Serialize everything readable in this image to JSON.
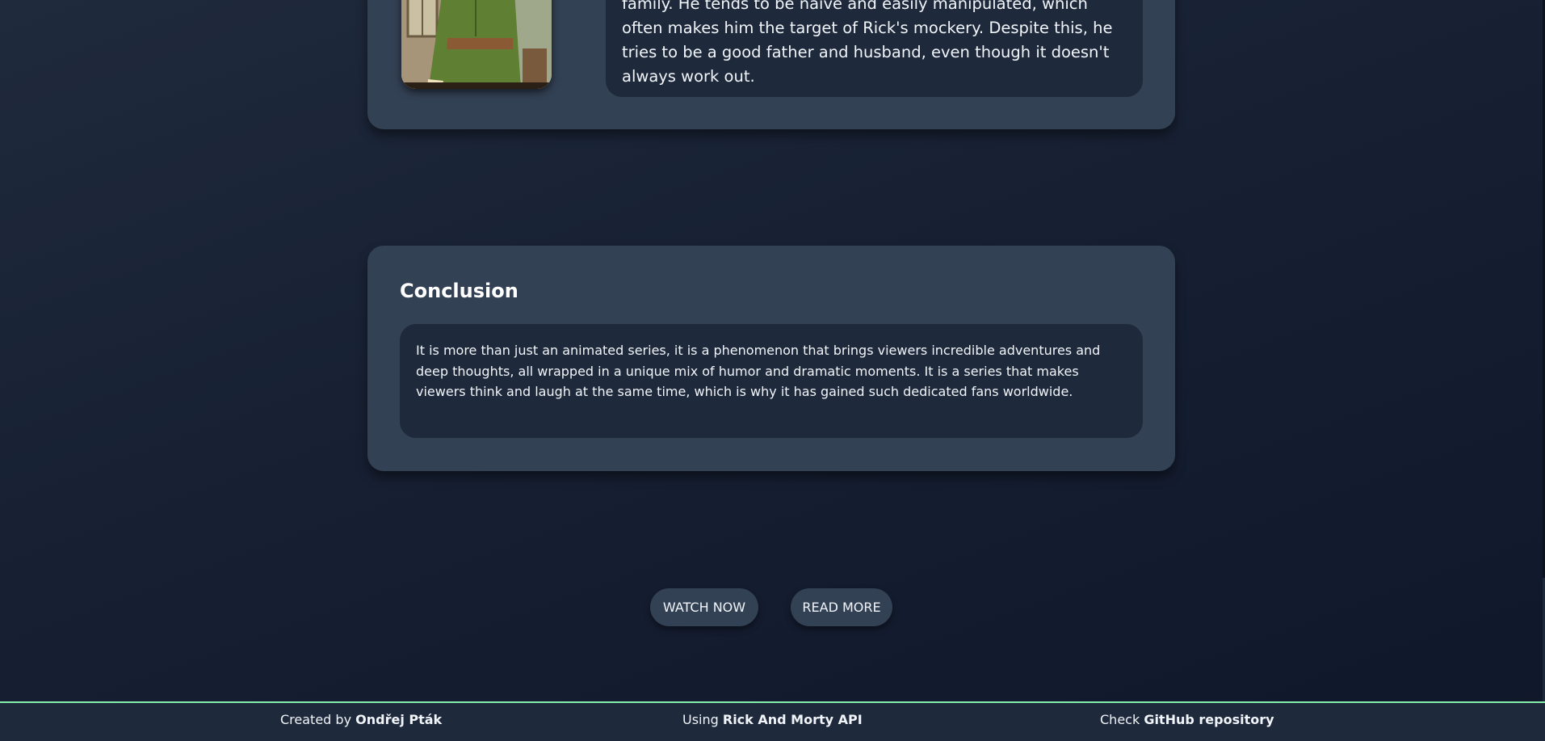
{
  "character_card": {
    "description": "family. He tends to be naive and easily manipulated, which\noften makes him the target of Rick's mockery. Despite this, he\ntries to be a good father and husband, even though it doesn't\nalways work out."
  },
  "conclusion": {
    "title": "Conclusion",
    "text": "It is more than just an animated series, it is a phenomenon that brings viewers incredible adventures and deep thoughts, all wrapped in a unique mix of humor and dramatic moments. It is a series that makes viewers think and laugh at the same time, which is why it has gained such dedicated fans worldwide."
  },
  "actions": {
    "watch_label": "WATCH NOW",
    "read_label": "READ MORE"
  },
  "footer": {
    "created_prefix": "Created by ",
    "created_name": "Ondřej Pták",
    "using_prefix": "Using ",
    "using_name": "Rick And Morty API",
    "check_prefix": "Check ",
    "check_name": "GitHub repository",
    "accent_color": "#86efac"
  }
}
